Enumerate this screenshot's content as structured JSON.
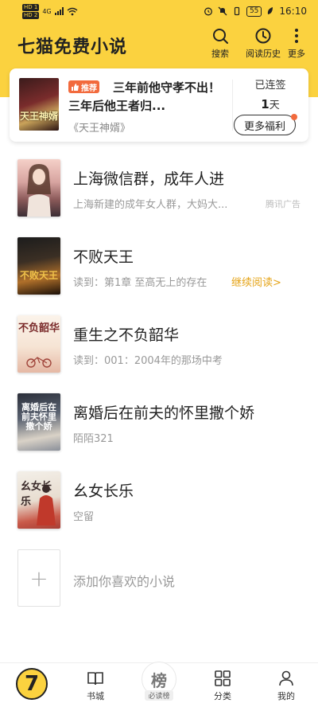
{
  "status_bar": {
    "sim1": "HD 1",
    "sim2": "HD 2",
    "network": "4G",
    "battery": "55",
    "time": "16:10"
  },
  "header": {
    "title": "七猫免费小说",
    "search_label": "搜索",
    "history_label": "阅读历史",
    "more_label": "更多"
  },
  "recommend": {
    "tag": "推荐",
    "headline": "三年前他守孝不出！三年后他王者归...",
    "book_name": "《天王神婿》",
    "cover_text": "天王神婿",
    "streak_label": "已连签",
    "streak_days": "1",
    "streak_unit": "天",
    "welfare_button": "更多福利"
  },
  "books": [
    {
      "title": "上海微信群，成年人进",
      "subtitle": "上海新建的成年女人群，大妈大...",
      "ad": "腾讯广告",
      "cover_text": ""
    },
    {
      "title": "不败天王",
      "subtitle": "读到：第1章 至高无上的存在",
      "action": "继续阅读>",
      "cover_text": "不败天王"
    },
    {
      "title": "重生之不负韶华",
      "subtitle": "读到：001：2004年的那场中考",
      "cover_text": "不负韶华"
    },
    {
      "title": "离婚后在前夫的怀里撒个娇",
      "subtitle": "陌陌321",
      "cover_text": "离婚后在前夫怀里撒个娇"
    },
    {
      "title": "幺女长乐",
      "subtitle": "空留",
      "cover_text": "幺女长乐"
    }
  ],
  "add_book": {
    "icon": "+",
    "label": "添加你喜欢的小说"
  },
  "bottom_nav": {
    "logo_text": "7",
    "shelf": "书城",
    "rank_icon_text": "榜",
    "rank": "必读榜",
    "category": "分类",
    "me": "我的"
  },
  "colors": {
    "brand_yellow": "#fbd23f",
    "accent_orange": "#f26a3d",
    "continue_gold": "#e5a418"
  }
}
